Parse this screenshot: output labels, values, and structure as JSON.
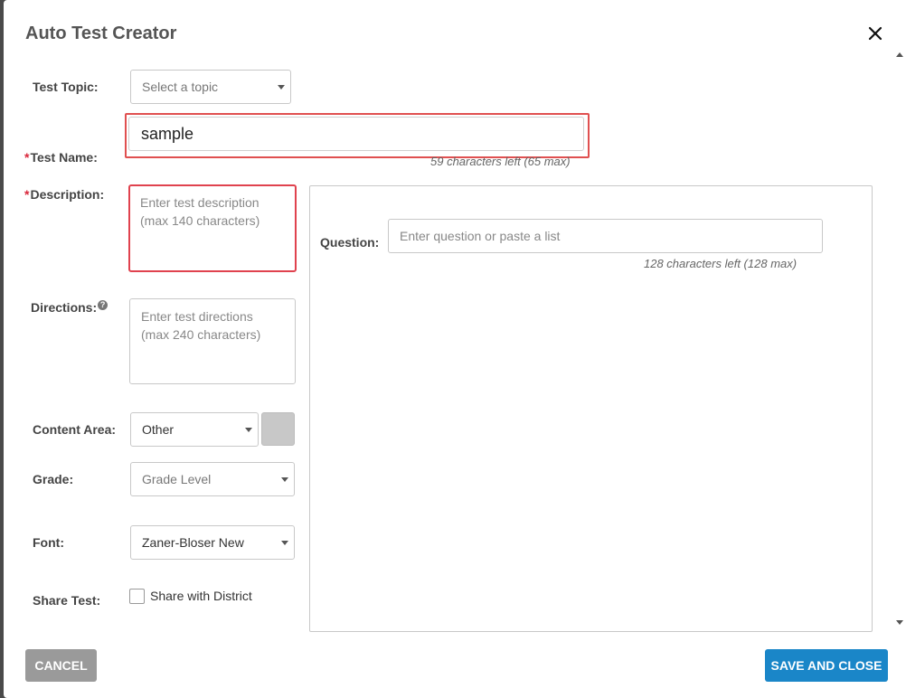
{
  "dialog": {
    "title": "Auto Test Creator"
  },
  "labels": {
    "test_topic": "Test Topic:",
    "test_name": "Test Name:",
    "description": "Description:",
    "directions": "Directions:",
    "content_area": "Content Area:",
    "grade": "Grade:",
    "font": "Font:",
    "share_test": "Share Test:",
    "question": "Question:",
    "required_mark": "*",
    "help_glyph": "?"
  },
  "fields": {
    "test_topic": {
      "placeholder": "Select a topic"
    },
    "test_name": {
      "value": "sample",
      "hint": "59 characters left (65 max)"
    },
    "description": {
      "placeholder": "Enter test description (max 140 characters)"
    },
    "directions": {
      "placeholder": "Enter test directions (max 240 characters)"
    },
    "content_area": {
      "value": "Other"
    },
    "grade": {
      "placeholder": "Grade Level"
    },
    "font": {
      "value": "Zaner-Bloser New"
    },
    "share": {
      "label": "Share with District",
      "checked": false
    },
    "question": {
      "placeholder": "Enter question or paste a list",
      "hint": "128 characters left (128 max)"
    }
  },
  "buttons": {
    "cancel": "CANCEL",
    "save_close": "SAVE AND CLOSE"
  },
  "colors": {
    "primary": "#1a86c8",
    "cancel": "#9a9a9a",
    "error": "#e0424e",
    "required": "#d9263a",
    "content_area_swatch": "#c8c8c8"
  }
}
